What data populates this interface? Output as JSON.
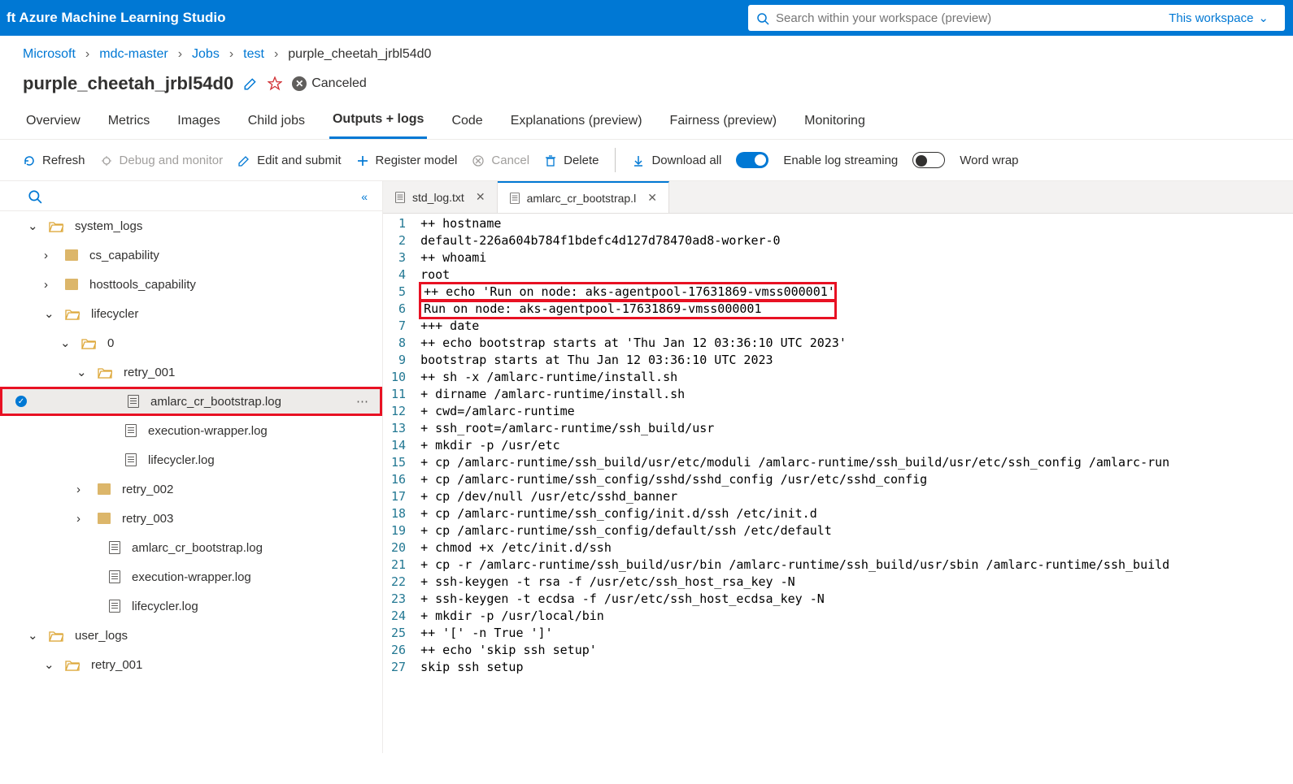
{
  "brand": "ft Azure Machine Learning Studio",
  "search": {
    "placeholder": "Search within your workspace (preview)",
    "scope_label": "This workspace"
  },
  "breadcrumb": [
    "Microsoft",
    "mdc-master",
    "Jobs",
    "test",
    "purple_cheetah_jrbl54d0"
  ],
  "title": "purple_cheetah_jrbl54d0",
  "status": "Canceled",
  "tabs": [
    "Overview",
    "Metrics",
    "Images",
    "Child jobs",
    "Outputs + logs",
    "Code",
    "Explanations (preview)",
    "Fairness (preview)",
    "Monitoring"
  ],
  "active_tab": 4,
  "toolbar": {
    "refresh": "Refresh",
    "debug": "Debug and monitor",
    "edit": "Edit and submit",
    "register": "Register model",
    "cancel": "Cancel",
    "delete": "Delete",
    "download": "Download all",
    "log_stream": "Enable log streaming",
    "word_wrap": "Word wrap"
  },
  "tree": {
    "system_logs": "system_logs",
    "cs_capability": "cs_capability",
    "hosttools_capability": "hosttools_capability",
    "lifecycler": "lifecycler",
    "zero": "0",
    "retry_001": "retry_001",
    "amlarc_boot": "amlarc_cr_bootstrap.log",
    "exec_wrap": "execution-wrapper.log",
    "lc_log": "lifecycler.log",
    "retry_002": "retry_002",
    "retry_003": "retry_003",
    "amlarc_boot2": "amlarc_cr_bootstrap.log",
    "exec_wrap2": "execution-wrapper.log",
    "lc_log2": "lifecycler.log",
    "user_logs": "user_logs",
    "retry_001b": "retry_001"
  },
  "editor_tabs": [
    {
      "label": "std_log.txt",
      "active": false
    },
    {
      "label": "amlarc_cr_bootstrap.l",
      "active": true
    }
  ],
  "log_lines": [
    "++ hostname",
    "default-226a604b784f1bdefc4d127d78470ad8-worker-0",
    "++ whoami",
    "root",
    "++ echo 'Run on node: aks-agentpool-17631869-vmss000001'",
    "Run on node: aks-agentpool-17631869-vmss000001",
    "+++ date",
    "++ echo bootstrap starts at 'Thu Jan 12 03:36:10 UTC 2023'",
    "bootstrap starts at Thu Jan 12 03:36:10 UTC 2023",
    "++ sh -x /amlarc-runtime/install.sh",
    "+ dirname /amlarc-runtime/install.sh",
    "+ cwd=/amlarc-runtime",
    "+ ssh_root=/amlarc-runtime/ssh_build/usr",
    "+ mkdir -p /usr/etc",
    "+ cp /amlarc-runtime/ssh_build/usr/etc/moduli /amlarc-runtime/ssh_build/usr/etc/ssh_config /amlarc-run",
    "+ cp /amlarc-runtime/ssh_config/sshd/sshd_config /usr/etc/sshd_config",
    "+ cp /dev/null /usr/etc/sshd_banner",
    "+ cp /amlarc-runtime/ssh_config/init.d/ssh /etc/init.d",
    "+ cp /amlarc-runtime/ssh_config/default/ssh /etc/default",
    "+ chmod +x /etc/init.d/ssh",
    "+ cp -r /amlarc-runtime/ssh_build/usr/bin /amlarc-runtime/ssh_build/usr/sbin /amlarc-runtime/ssh_build",
    "+ ssh-keygen -t rsa -f /usr/etc/ssh_host_rsa_key -N",
    "+ ssh-keygen -t ecdsa -f /usr/etc/ssh_host_ecdsa_key -N",
    "+ mkdir -p /usr/local/bin",
    "++ '[' -n True ']'",
    "++ echo 'skip ssh setup'",
    "skip ssh setup"
  ],
  "highlight_lines": [
    5,
    6
  ]
}
